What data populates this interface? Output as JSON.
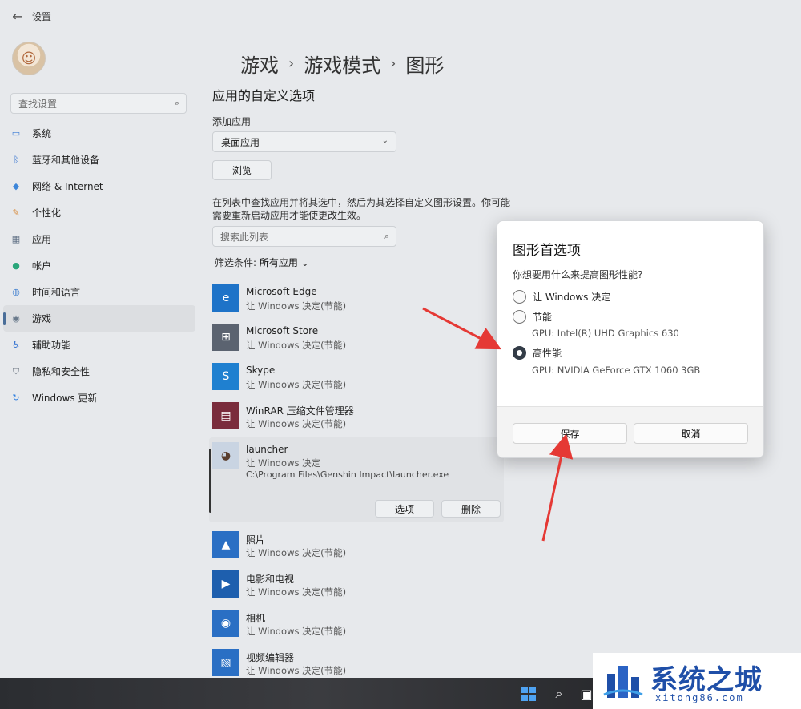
{
  "window": {
    "title": "设置",
    "back_icon": "arrow-left-icon"
  },
  "search": {
    "placeholder": "查找设置"
  },
  "sidebar": {
    "items": [
      {
        "label": "系统",
        "icon": "monitor-icon",
        "color": "#3a7bd5"
      },
      {
        "label": "蓝牙和其他设备",
        "icon": "bluetooth-icon",
        "color": "#2f6fd0"
      },
      {
        "label": "网络 & Internet",
        "icon": "wifi-icon",
        "color": "#3d86d9"
      },
      {
        "label": "个性化",
        "icon": "brush-icon",
        "color": "#d88a3a"
      },
      {
        "label": "应用",
        "icon": "apps-icon",
        "color": "#5a6b80"
      },
      {
        "label": "帐户",
        "icon": "person-icon",
        "color": "#2aa67a"
      },
      {
        "label": "时间和语言",
        "icon": "globe-clock-icon",
        "color": "#3f7fcf"
      },
      {
        "label": "游戏",
        "icon": "gamepad-icon",
        "color": "#6a7a8c"
      },
      {
        "label": "辅助功能",
        "icon": "accessibility-icon",
        "color": "#2f6fd0"
      },
      {
        "label": "隐私和安全性",
        "icon": "shield-icon",
        "color": "#6b7480"
      },
      {
        "label": "Windows 更新",
        "icon": "update-icon",
        "color": "#2f7fe0"
      }
    ],
    "active_index": 7
  },
  "breadcrumb": {
    "part1": "游戏",
    "part2": "游戏模式",
    "part3": "图形",
    "separator": "›"
  },
  "main": {
    "section_title": "应用的自定义选项",
    "add_app_label": "添加应用",
    "select_value": "桌面应用",
    "browse_label": "浏览",
    "description": "在列表中查找应用并将其选中，然后为其选择自定义图形设置。你可能需要重新启动应用才能使更改生效。",
    "list_search_placeholder": "搜索此列表",
    "filter_label": "筛选条件:",
    "filter_value": "所有应用"
  },
  "apps": [
    {
      "name": "Microsoft Edge",
      "sub": "让 Windows 决定(节能)",
      "icon": "edge-icon",
      "color": "#1e73c8"
    },
    {
      "name": "Microsoft Store",
      "sub": "让 Windows 决定(节能)",
      "icon": "store-icon",
      "color": "#5b6370"
    },
    {
      "name": "Skype",
      "sub": "让 Windows 决定(节能)",
      "icon": "skype-icon",
      "color": "#1f80d0"
    },
    {
      "name": "WinRAR 压缩文件管理器",
      "sub": "让 Windows 决定(节能)",
      "icon": "winrar-icon",
      "color": "#7a2c3c"
    }
  ],
  "expanded_app": {
    "name": "launcher",
    "sub": "让 Windows 决定",
    "path": "C:\\Program Files\\Genshin Impact\\launcher.exe",
    "options_label": "选项",
    "delete_label": "删除",
    "icon": "genshin-launcher-icon"
  },
  "apps_after": [
    {
      "name": "照片",
      "sub": "让 Windows 决定(节能)",
      "icon": "photos-icon",
      "color": "#2a6fc4"
    },
    {
      "name": "电影和电视",
      "sub": "让 Windows 决定(节能)",
      "icon": "movies-tv-icon",
      "color": "#1e5fae"
    },
    {
      "name": "相机",
      "sub": "让 Windows 决定(节能)",
      "icon": "camera-icon",
      "color": "#2a6fc4"
    },
    {
      "name": "视频编辑器",
      "sub": "让 Windows 决定(节能)",
      "icon": "video-editor-icon",
      "color": "#2a6fc4"
    }
  ],
  "modal": {
    "title": "图形首选项",
    "question": "你想要用什么来提高图形性能?",
    "options": [
      {
        "label": "让 Windows 决定",
        "gpu": "",
        "checked": false
      },
      {
        "label": "节能",
        "gpu": "GPU: Intel(R) UHD Graphics 630",
        "checked": false
      },
      {
        "label": "高性能",
        "gpu": "GPU: NVIDIA GeForce GTX 1060 3GB",
        "checked": true
      }
    ],
    "save_label": "保存",
    "cancel_label": "取消"
  },
  "taskbar": {
    "icons": [
      "windows-start-icon",
      "search-icon",
      "task-view-icon"
    ]
  },
  "watermark": {
    "title": "系统之城",
    "sub": "xitong86.com",
    "color": "#1f4fa8"
  },
  "annotation": {
    "arrow_color": "#e53935"
  }
}
